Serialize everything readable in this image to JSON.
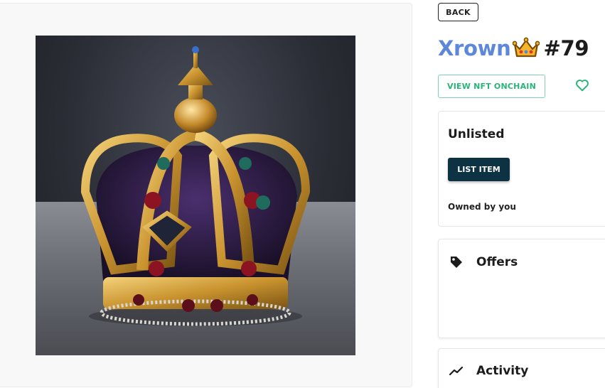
{
  "nav": {
    "back_label": "BACK"
  },
  "nft": {
    "collection": "Xrown",
    "collection_emoji": "crown-emoji",
    "number": "#79",
    "image_subject": "crown-image"
  },
  "actions": {
    "view_onchain_label": "VIEW NFT ONCHAIN",
    "favorite_icon": "heart-icon"
  },
  "listing": {
    "status": "Unlisted",
    "list_button_label": "LIST ITEM",
    "owner_text": "Owned by you"
  },
  "sections": {
    "offers": {
      "label": "Offers",
      "icon": "tag-icon"
    },
    "activity": {
      "label": "Activity",
      "icon": "trend-icon"
    }
  },
  "colors": {
    "collection_title": "#5d87d8",
    "onchain_accent": "#2bb47a",
    "list_button_bg": "#0d3243"
  }
}
